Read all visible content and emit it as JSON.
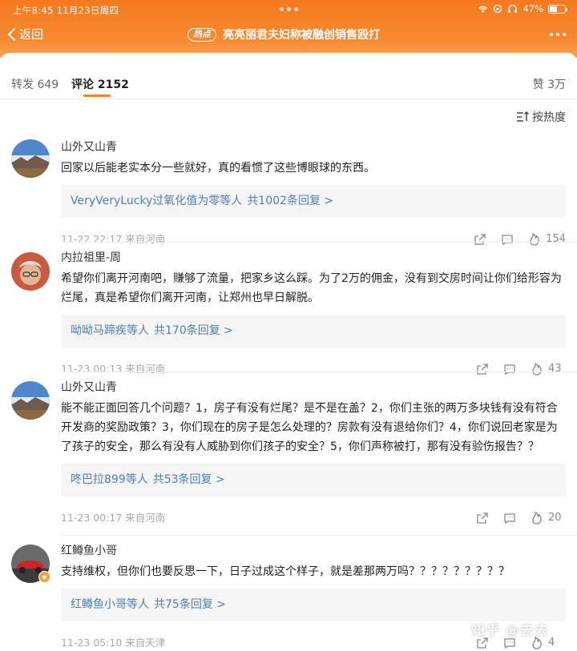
{
  "status_bar": {
    "time": "上午8:45  11月23日周四",
    "battery": "47%",
    "battery_level": 0.47
  },
  "nav": {
    "back_label": "返回",
    "badge": "热点",
    "title": "亮亮丽君夫妇称被融创销售殴打"
  },
  "tabs": {
    "repost": "转发 649",
    "comment": "评论 2152",
    "like": "赞 3万"
  },
  "sort_label": "按热度",
  "comments": [
    {
      "user": "山外又山青",
      "text": "回家以后能老实本分一些就好，真的看惯了这些博眼球的东西。",
      "reply_users": "VeryVeryLucky过氧化值为零等人",
      "reply_count": "共1002条回复 >",
      "time_loc": "11-22 22:17 来自河南",
      "likes": "154"
    },
    {
      "user": "内拉祖里-周",
      "text": "希望你们离开河南吧，赚够了流量，把家乡这么踩。为了2万的佣金，没有到交房时间让你们给形容为烂尾，真是希望你们离开河南，让郑州也早日解脱。",
      "reply_users": "呦呦马蹄疾等人",
      "reply_count": "共170条回复 >",
      "time_loc": "11-23 00:13 来自河南",
      "likes": "43"
    },
    {
      "user": "山外又山青",
      "text": "能不能正面回答几个问题？1，房子有没有烂尾？是不是在盖？2，你们主张的两万多块钱有没有符合开发商的奖励政策？3，你们现在的房子是怎么处理的？房款有没有退给你们？4，你们说回老家是为了孩子的安全，那么有没有人威胁到你们孩子的安全？5，你们声称被打，那有没有验伤报告？？",
      "reply_users": "咚巴拉899等人",
      "reply_count": "共53条回复 >",
      "time_loc": "11-23 00:17 来自河南",
      "likes": "20"
    },
    {
      "user": "红鳟鱼小哥",
      "text": "支持维权，但你们也要反思一下，日子过成这个样子，就是差那两万吗？？？？？？？？？",
      "reply_users": "红鳟鱼小哥等人",
      "reply_count": "共75条回复 >",
      "time_loc": "11-23 05:10 来自天津",
      "likes": "4"
    }
  ],
  "watermark": "知乎 @去去",
  "icons": [
    "back-chevron-icon",
    "more-dots-icon",
    "sort-icon",
    "share-icon",
    "comment-icon",
    "like-flame-icon",
    "wifi-icon",
    "headphones-icon",
    "battery-icon"
  ],
  "colors": {
    "accent": "#f7801f",
    "link": "#4f7db8",
    "header": "#f57a1e"
  }
}
